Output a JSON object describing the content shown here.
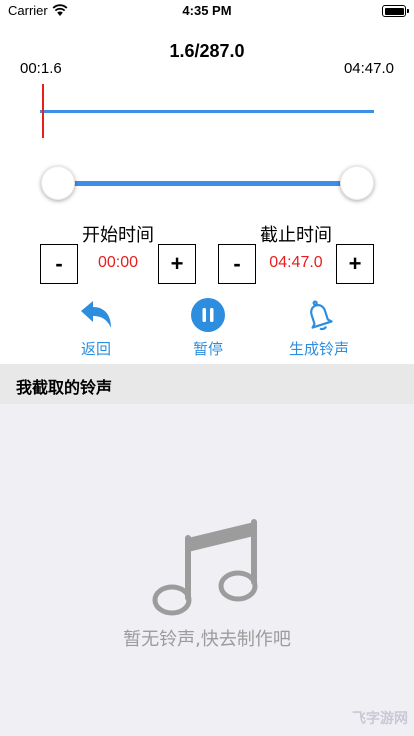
{
  "status_bar": {
    "carrier": "Carrier",
    "time": "4:35 PM"
  },
  "player": {
    "progress": "1.6/287.0",
    "current_time": "00:1.6",
    "total_time": "04:47.0"
  },
  "trim": {
    "start_label": "开始时间",
    "end_label": "截止时间",
    "start_value": "00:00",
    "end_value": "04:47.0",
    "minus": "-",
    "plus": "+"
  },
  "actions": {
    "back": "返回",
    "pause": "暂停",
    "make": "生成铃声"
  },
  "section": {
    "title": "我截取的铃声"
  },
  "empty": {
    "message": "暂无铃声,快去制作吧"
  },
  "watermark": "飞字游网",
  "colors": {
    "accent": "#2d8ee0",
    "track": "#3c8fe8",
    "time_red": "#e81e1e",
    "empty_gray": "#9c9c9c"
  }
}
